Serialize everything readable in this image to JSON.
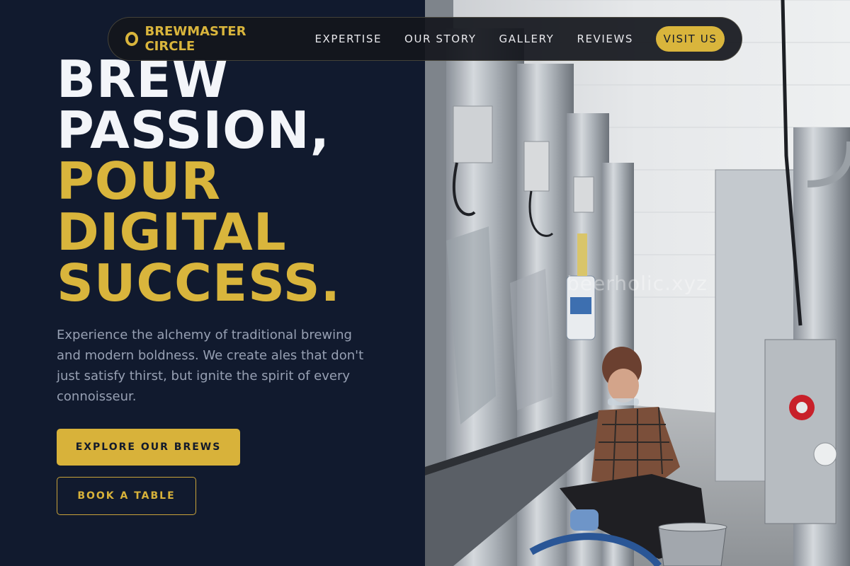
{
  "nav": {
    "brand": "BREWMASTER CIRCLE",
    "links": [
      "EXPERTISE",
      "OUR STORY",
      "GALLERY",
      "REVIEWS"
    ],
    "cta": "VISIT US"
  },
  "hero": {
    "title_lines": [
      "BREW",
      "PASSION,",
      "POUR",
      "DIGITAL",
      "SUCCESS."
    ],
    "description": "Experience the alchemy of traditional brewing and modern boldness. We create ales that don't just satisfy thirst, but ignite the spirit of every connoisseur.",
    "primary_button": "EXPLORE OUR BREWS",
    "secondary_button": "BOOK A TABLE"
  },
  "watermark": "beerholic.xyz",
  "colors": {
    "background": "#111a2e",
    "accent": "#d9b53c",
    "text_light": "#f3f5f9",
    "text_muted": "#97a0b3"
  },
  "icons": [
    "ring-logo-icon"
  ]
}
